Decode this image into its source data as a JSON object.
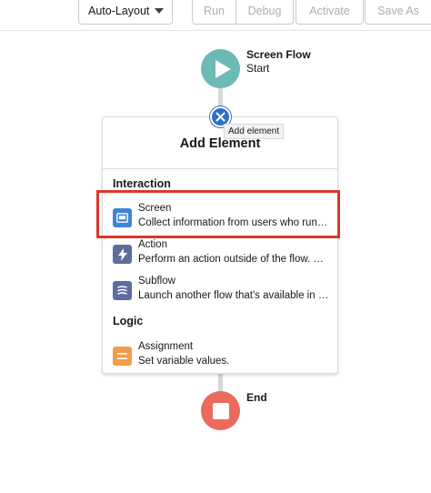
{
  "toolbar": {
    "layout_dropdown": {
      "label": "Auto-Layout"
    },
    "run_label": "Run",
    "debug_label": "Debug",
    "activate_label": "Activate",
    "save_as_label": "Save As"
  },
  "start_node": {
    "title": "Screen Flow",
    "subtitle": "Start",
    "icon": "play-icon",
    "color": "#6cbab4"
  },
  "close_button": {
    "icon": "close-icon",
    "color": "#2f6fc8"
  },
  "tooltip": {
    "text": "Add element"
  },
  "panel": {
    "title": "Add Element",
    "sections": [
      {
        "label": "Interaction",
        "items": [
          {
            "name": "Screen",
            "description": "Collect information from users who run t...",
            "icon": "screen-icon",
            "color": "#3d84d9"
          },
          {
            "name": "Action",
            "description": "Perform an action outside of the flow. Ch...",
            "icon": "lightning-icon",
            "color": "#5c6d9e"
          },
          {
            "name": "Subflow",
            "description": "Launch another flow that's available in y...",
            "icon": "subflow-icon",
            "color": "#5c6d9e"
          }
        ]
      },
      {
        "label": "Logic",
        "items": [
          {
            "name": "Assignment",
            "description": "Set variable values.",
            "icon": "assignment-icon",
            "color": "#f29d4b"
          }
        ]
      }
    ]
  },
  "end_node": {
    "title": "End",
    "icon": "stop-icon",
    "color": "#ea6b5c"
  },
  "highlight_color": "#d9372a"
}
